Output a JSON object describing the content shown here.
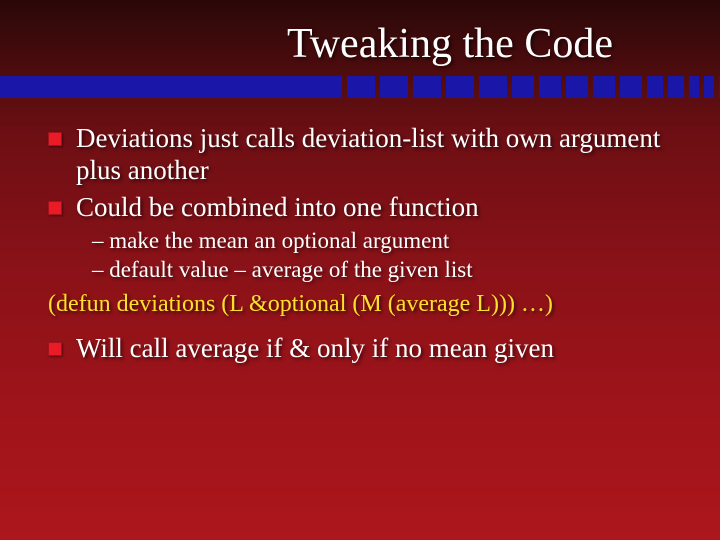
{
  "title": "Tweaking the Code",
  "bullets": {
    "b1": "Deviations just calls deviation-list with own argument plus another",
    "b2": "Could be combined into one function",
    "sub1": "– make the mean an optional argument",
    "sub2": "– default value – average of the given list",
    "code": "(defun deviations (L &optional (M (average L))) …)",
    "b3": "Will call average if & only if no mean given"
  }
}
